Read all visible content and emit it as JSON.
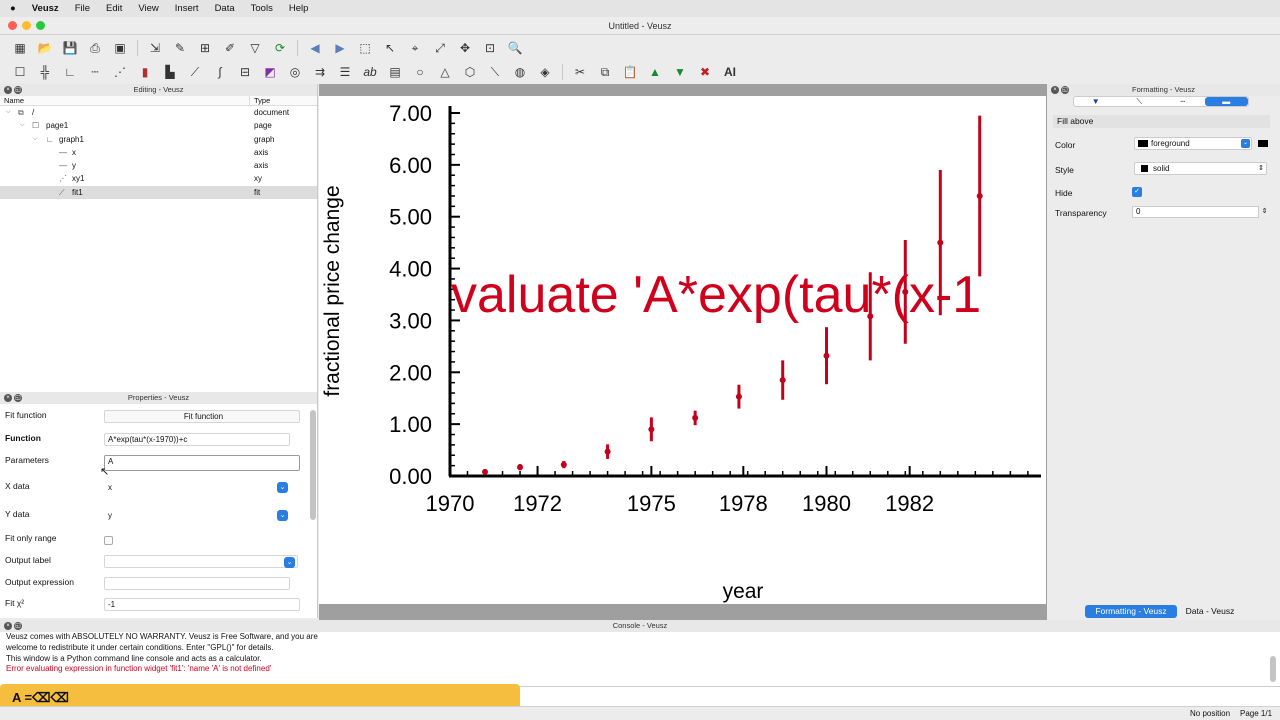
{
  "menubar": {
    "app": "Veusz",
    "items": [
      "File",
      "Edit",
      "View",
      "Insert",
      "Data",
      "Tools",
      "Help"
    ]
  },
  "window_title": "Untitled - Veusz",
  "editing": {
    "title": "Editing - Veusz",
    "col_name": "Name",
    "col_type": "Type",
    "rows": [
      {
        "name": "/",
        "type": "document"
      },
      {
        "name": "page1",
        "type": "page"
      },
      {
        "name": "graph1",
        "type": "graph"
      },
      {
        "name": "x",
        "type": "axis"
      },
      {
        "name": "y",
        "type": "axis"
      },
      {
        "name": "xy1",
        "type": "xy"
      },
      {
        "name": "fit1",
        "type": "fit"
      }
    ]
  },
  "properties": {
    "title": "Properties - Veusz",
    "fit_function_label": "Fit function",
    "fit_function_button": "Fit function",
    "function_label": "Function",
    "function_value": "A*exp(tau*(x-1970))+c",
    "parameters_label": "Parameters",
    "parameters_value": "A",
    "xdata_label": "X data",
    "xdata_value": "x",
    "ydata_label": "Y data",
    "ydata_value": "y",
    "fit_only_range_label": "Fit only range",
    "output_label_label": "Output label",
    "output_expression_label": "Output expression",
    "fit_chi2_label": "Fit χ²",
    "fit_chi2_value": "-1"
  },
  "formatting": {
    "title": "Formatting - Veusz",
    "section": "Fill above",
    "color_label": "Color",
    "color_value": "foreground",
    "style_label": "Style",
    "style_value": "solid",
    "hide_label": "Hide",
    "transparency_label": "Transparency",
    "transparency_value": "0",
    "tab_formatting": "Formatting - Veusz",
    "tab_data": "Data - Veusz"
  },
  "console": {
    "title": "Console - Veusz",
    "line1": "Veusz comes with ABSOLUTELY NO WARRANTY. Veusz is Free Software, and you are",
    "line2": "welcome to redistribute it under certain conditions. Enter \"GPL()\" for details.",
    "line3": "This window is a Python command line console and acts as a calculator.",
    "error": "Error evaluating expression in function widget 'fit1': 'name 'A' is not defined'",
    "prompt": ">",
    "key_overlay": "A =⌫⌫"
  },
  "status": {
    "position": "No position",
    "page": "Page 1/1"
  },
  "colors": {
    "accent": "#2a7de1",
    "error": "#d0001c",
    "overlay": "#f5be3f"
  },
  "chart_data": {
    "type": "scatter",
    "xlabel": "year",
    "ylabel": "fractional price change",
    "xlim": [
      1970,
      1983.5
    ],
    "ylim": [
      0,
      7
    ],
    "xticks": [
      "1970",
      "1972",
      "1975",
      "1978",
      "1980",
      "1982"
    ],
    "yticks": [
      "0.00",
      "1.00",
      "2.00",
      "3.00",
      "4.00",
      "5.00",
      "6.00",
      "7.00"
    ],
    "overlay_text": "valuate 'A*exp(tau*(x-1",
    "points": [
      {
        "x": 1970.8,
        "y": 0.08,
        "err": 0.04
      },
      {
        "x": 1971.6,
        "y": 0.17,
        "err": 0.06
      },
      {
        "x": 1972.6,
        "y": 0.22,
        "err": 0.07
      },
      {
        "x": 1973.6,
        "y": 0.47,
        "err": 0.14
      },
      {
        "x": 1974.6,
        "y": 0.9,
        "err": 0.23
      },
      {
        "x": 1975.6,
        "y": 1.12,
        "err": 0.14
      },
      {
        "x": 1976.6,
        "y": 1.53,
        "err": 0.23
      },
      {
        "x": 1977.6,
        "y": 1.85,
        "err": 0.38
      },
      {
        "x": 1978.6,
        "y": 2.32,
        "err": 0.55
      },
      {
        "x": 1979.6,
        "y": 3.08,
        "err": 0.85
      },
      {
        "x": 1980.4,
        "y": 3.55,
        "err": 1.0
      },
      {
        "x": 1981.2,
        "y": 4.5,
        "err": 1.4
      },
      {
        "x": 1982.1,
        "y": 5.4,
        "err": 1.55
      }
    ]
  }
}
